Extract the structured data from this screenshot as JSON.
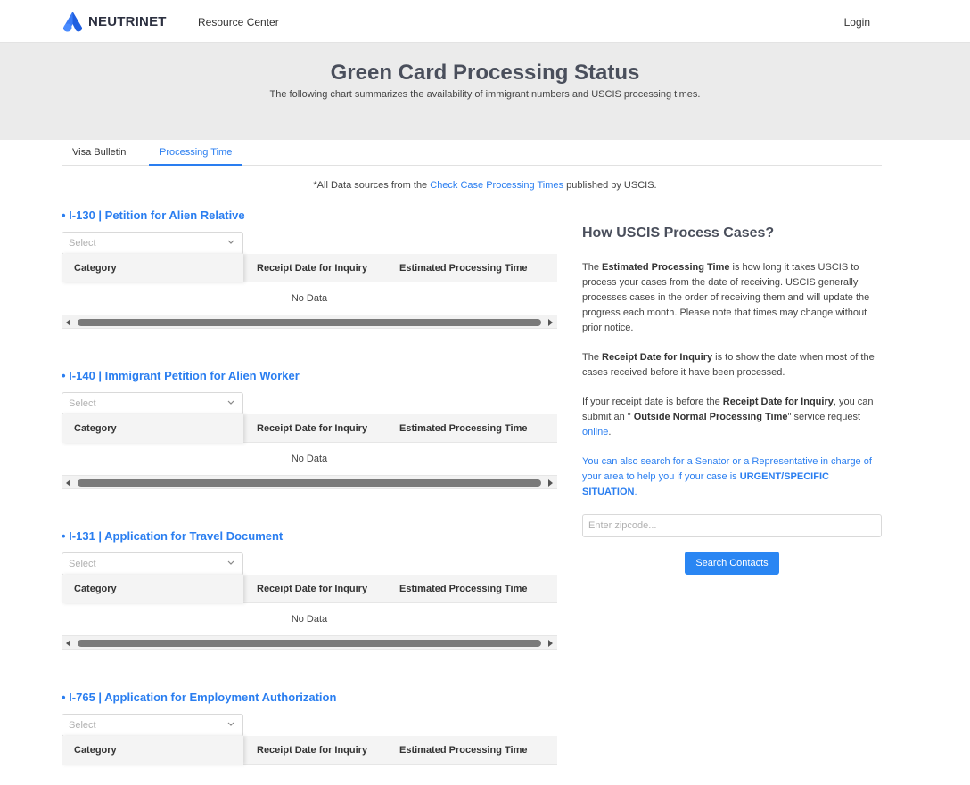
{
  "nav": {
    "brand": "NEUTRINET",
    "resource_center": "Resource Center",
    "login": "Login"
  },
  "hero": {
    "title": "Green Card Processing Status",
    "subtitle": "The following chart summarizes the availability of immigrant numbers and USCIS processing times."
  },
  "tabs": [
    {
      "label": "Visa Bulletin",
      "active": false
    },
    {
      "label": "Processing Time",
      "active": true
    }
  ],
  "source_note": {
    "prefix": "*All Data sources from the ",
    "link": "Check Case Processing Times",
    "suffix": " published by USCIS."
  },
  "table_headers": {
    "category": "Category",
    "receipt_date": "Receipt Date for Inquiry",
    "estimated_time": "Estimated Processing Time"
  },
  "select_placeholder": "Select",
  "empty_text": "No Data",
  "sections": [
    {
      "title": "• I-130 | Petition for Alien Relative"
    },
    {
      "title": "• I-140 | Immigrant Petition for Alien Worker"
    },
    {
      "title": "• I-131 | Application for Travel Document"
    },
    {
      "title": "• I-765 | Application for Employment Authorization"
    }
  ],
  "panel": {
    "title": "How USCIS Process Cases?",
    "p1_a": "The ",
    "p1_b": "Estimated Processing Time",
    "p1_c": " is how long it takes USCIS to process your cases from the date of receiving. USCIS generally processes cases in the order of receiving them and will update the progress each month. Please note that times may change without prior notice.",
    "p2_a": "The ",
    "p2_b": "Receipt Date for Inquiry",
    "p2_c": " is to show the date when most of the cases received before it have been processed.",
    "p3_a": "If your receipt date is before the ",
    "p3_b": "Receipt Date for Inquiry",
    "p3_c": ", you can submit an \" ",
    "p3_d": "Outside Normal Processing Time",
    "p3_e": "\" service request ",
    "p3_link": "online",
    "p3_f": ".",
    "p4_a": "You can also search for a Senator or a Representative in charge of your area to help you if your case is ",
    "p4_b": "URGENT/SPECIFIC SITUATION",
    "p4_c": ".",
    "zip_placeholder": "Enter zipcode...",
    "search_button": "Search Contacts"
  },
  "colors": {
    "accent": "#2a7ef0",
    "button": "#2a86f3",
    "hero_bg": "#ebebeb"
  }
}
